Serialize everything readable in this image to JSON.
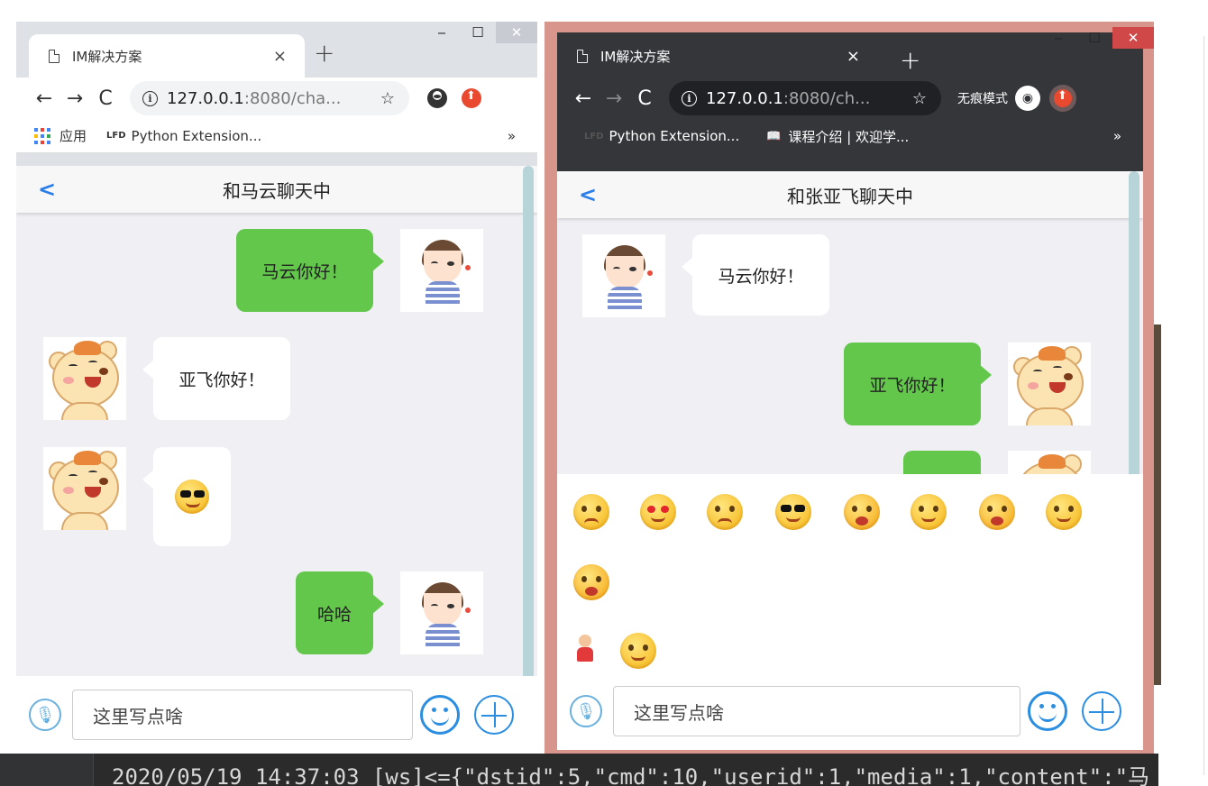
{
  "left_window": {
    "tab_title": "IM解决方案",
    "tab_close": "×",
    "new_tab": "+",
    "win_min": "‒",
    "win_max": "☐",
    "win_close": "✕",
    "nav_back": "←",
    "nav_forward": "→",
    "nav_reload": "C",
    "url_host": "127.0.0.1",
    "url_rest": ":8080/cha...",
    "star": "☆",
    "bookmarks": {
      "apps": "应用",
      "lfd": "LFD",
      "python": "Python Extension...",
      "more": "»"
    },
    "chat": {
      "back": "<",
      "title": "和马云聊天中",
      "messages": [
        {
          "side": "right",
          "type": "text",
          "text": "马云你好！"
        },
        {
          "side": "left",
          "type": "text",
          "text": "亚飞你好！"
        },
        {
          "side": "left",
          "type": "emoji",
          "emoji": "cool-sunglasses-emoji"
        },
        {
          "side": "right",
          "type": "text",
          "text": "哈哈"
        }
      ],
      "input_placeholder": "这里写点啥"
    }
  },
  "right_window": {
    "tab_title": "IM解决方案",
    "tab_close": "×",
    "new_tab": "+",
    "win_min": "‒",
    "win_max": "☐",
    "win_close": "✕",
    "nav_back": "←",
    "nav_forward": "→",
    "nav_reload": "C",
    "url_host": "127.0.0.1",
    "url_rest": ":8080/ch...",
    "star": "☆",
    "incognito_label": "无痕模式",
    "bookmarks": {
      "lfd": "LFD",
      "python": "Python Extension...",
      "course": "课程介绍 | 欢迎学...",
      "more": "»"
    },
    "chat": {
      "back": "<",
      "title": "和张亚飞聊天中",
      "messages": [
        {
          "side": "left",
          "type": "text",
          "text": "马云你好！"
        },
        {
          "side": "right",
          "type": "text",
          "text": "亚飞你好！"
        }
      ],
      "emoji_panel": [
        "dizzy-emoji",
        "heart-eyes-emoji",
        "angry-emoji",
        "cool-sunglasses-emoji",
        "crying-emoji",
        "sleepy-emoji",
        "shocked-emoji",
        "smirk-emoji",
        "sobbing-emoji"
      ],
      "emoji_tabs": [
        "sticker-emoji-tab",
        "smiley-emoji-tab"
      ],
      "input_placeholder": "这里写点啥"
    }
  },
  "terminal": {
    "line": "2020/05/19 14:37:03 [ws]<={\"dstid\":5,\"cmd\":10,\"userid\":1,\"media\":1,\"content\":\"马"
  }
}
